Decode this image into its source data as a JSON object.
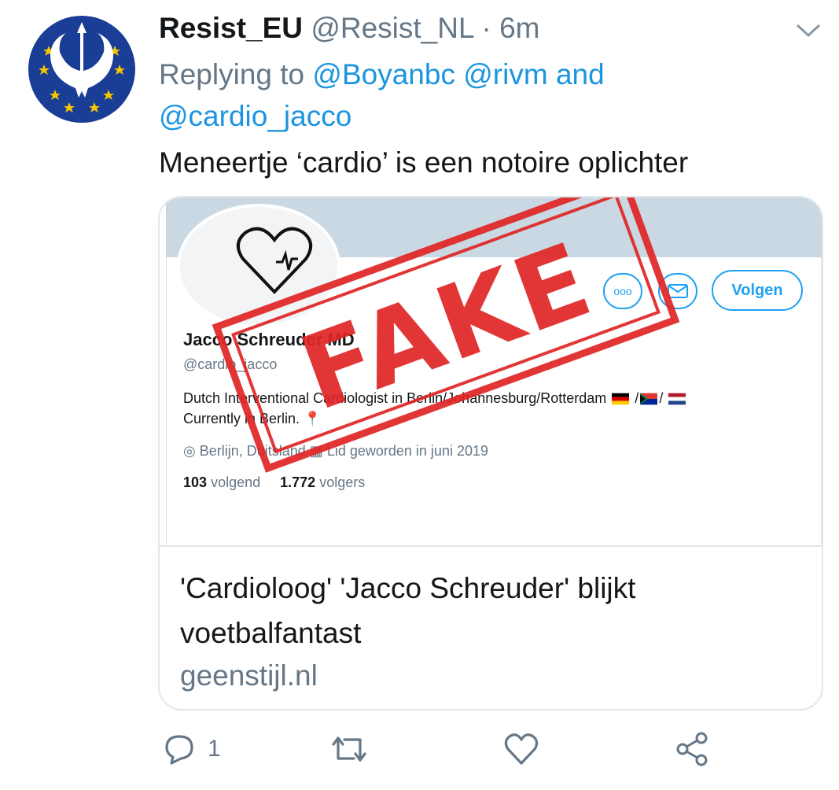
{
  "tweet": {
    "display_name": "Resist_EU",
    "handle": "@Resist_NL",
    "separator": "·",
    "time": "6m",
    "replying_to_label": "Replying to",
    "mentions": [
      "@Boyanbc",
      "@rivm",
      "@cardio_jacco"
    ],
    "mention_joiner": "and",
    "text": "Meneertje ‘cardio’ is een notoire oplichter",
    "avatar_icon": "rebel-alliance-eu-stars-icon",
    "colors": {
      "accent": "#1b95e0",
      "avatar_bg": "#1a3d96",
      "star": "#f6c700",
      "stamp": "#e02525"
    }
  },
  "card": {
    "image": {
      "profile_name": "Jacco Schreuder MD",
      "profile_handle": "@cardio_jacco",
      "bio_line1": "Dutch Interventional Cardiologist in Berlin/Johannesburg/Rotterdam",
      "bio_line2": "Currently in Berlin.",
      "location": "Berlijn, Duitsland",
      "joined": "Lid geworden in juni 2019",
      "following_count": "103",
      "following_label": "volgend",
      "followers_count": "1.772",
      "followers_label": "volgers",
      "follow_button": "Volgen",
      "more_button": "ooo",
      "stamp_text": "FAKE"
    },
    "title": "'Cardioloog' 'Jacco Schreuder' blijkt voetbalfantast",
    "domain": "geenstijl.nl"
  },
  "actions": {
    "reply_count": "1",
    "icons": [
      "reply-icon",
      "retweet-icon",
      "like-icon",
      "share-icon"
    ]
  }
}
